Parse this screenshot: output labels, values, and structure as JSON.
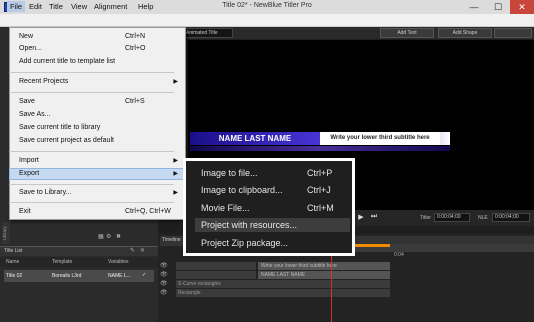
{
  "window": {
    "title": "Title 02* - NewBlue Titler Pro",
    "min": "—",
    "max": "☐",
    "close": "✕"
  },
  "menubar": {
    "items": [
      "File",
      "Edit",
      "Title",
      "View",
      "Alignment",
      "Help"
    ]
  },
  "file_menu": {
    "items": [
      {
        "label": "New",
        "shortcut": "Ctrl+N"
      },
      {
        "label": "Open...",
        "shortcut": "Ctrl+O"
      },
      {
        "label": "Add current title to template list",
        "shortcut": ""
      },
      {
        "label": "Recent Projects",
        "shortcut": "",
        "submenu": "▶"
      },
      {
        "label": "Save",
        "shortcut": "Ctrl+S"
      },
      {
        "label": "Save As...",
        "shortcut": ""
      },
      {
        "label": "Save current title to library",
        "shortcut": ""
      },
      {
        "label": "Save current project as default",
        "shortcut": ""
      },
      {
        "label": "Import",
        "shortcut": "",
        "submenu": "▶"
      },
      {
        "label": "Export",
        "shortcut": "",
        "submenu": "▶"
      },
      {
        "label": "Save to Library...",
        "shortcut": "",
        "submenu": "▶"
      },
      {
        "label": "Exit",
        "shortcut": "Ctrl+Q, Ctrl+W"
      }
    ]
  },
  "export_submenu": {
    "items": [
      {
        "label": "Image to file...",
        "shortcut": "Ctrl+P"
      },
      {
        "label": "Image to clipboard...",
        "shortcut": "Ctrl+J"
      },
      {
        "label": "Movie File...",
        "shortcut": "Ctrl+M"
      },
      {
        "label": "Project with resources...",
        "shortcut": ""
      },
      {
        "label": "Project Zip package...",
        "shortcut": ""
      }
    ]
  },
  "toolbar": {
    "template_select": "Animated Title",
    "add_text": "Add Text",
    "add_shape": "Add Shape"
  },
  "preview": {
    "name": "NAME LAST NAME",
    "subtitle": "Write your lower third subtitle here"
  },
  "transport": {
    "titler_label": "Titler",
    "titler_time": "0:00:04;00",
    "nle_label": "NLE",
    "nle_time": "0:00:04;00"
  },
  "title_list": {
    "header": "Title List",
    "columns": [
      "Name",
      "Template",
      "Variables"
    ],
    "row": {
      "name": "Title 02",
      "template": "Borealis L3rd",
      "variables": "NAME L..."
    }
  },
  "library_tab": "Library",
  "timeline": {
    "header": "Timeline",
    "marker": "0:04",
    "tracks": [
      {
        "label": "",
        "clip": "Write your lower third subtitle here"
      },
      {
        "label": "",
        "clip": "NAME LAST NAME"
      },
      {
        "label": "S-Curve rectangles",
        "clip": ""
      },
      {
        "label": "Rectangle",
        "clip": ""
      }
    ]
  }
}
